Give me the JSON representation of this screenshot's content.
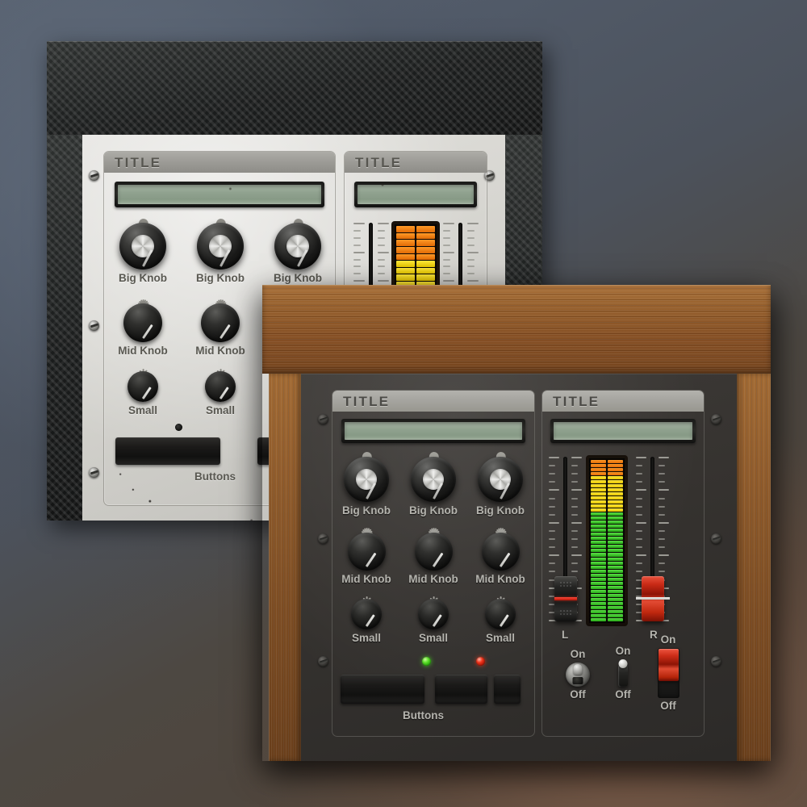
{
  "scene": {
    "background_gradient": [
      "#5d6775",
      "#4c525c",
      "#574c42"
    ],
    "units": [
      "back-carbon-rack",
      "front-wood-rack"
    ]
  },
  "back_unit": {
    "name": "carbon-fiber-rack-unit",
    "chassis_material": "carbon-fiber",
    "faceplate_material": "brushed-aluminum",
    "left_module": {
      "title": "TITLE",
      "display_value": "",
      "big_knobs": [
        {
          "label": "Big Knob",
          "value": 0.28
        },
        {
          "label": "Big Knob",
          "value": 0.28
        },
        {
          "label": "Big Knob",
          "value": 0.28
        }
      ],
      "mid_knobs": [
        {
          "label": "Mid Knob",
          "value": 0.2
        },
        {
          "label": "Mid Knob",
          "value": 0.2
        }
      ],
      "small_knobs": [
        {
          "label": "Small",
          "value": 0.2
        },
        {
          "label": "Small",
          "value": 0.2
        }
      ],
      "buttons_label": "Buttons",
      "buttons": [
        {
          "led": "off"
        },
        {
          "led": "green"
        }
      ]
    },
    "right_module": {
      "title": "TITLE",
      "display_value": "",
      "meter": {
        "total_segments": 20,
        "lit_segments": 20,
        "orange": 5,
        "yellow": 15,
        "green": 0
      }
    }
  },
  "front_unit": {
    "name": "wood-rack-unit",
    "chassis_material": "wood",
    "faceplate_material": "dark-metal",
    "left_module": {
      "title": "TITLE",
      "display_value": "",
      "big_knobs": [
        {
          "label": "Big Knob",
          "value": 0.28
        },
        {
          "label": "Big Knob",
          "value": 0.28
        },
        {
          "label": "Big Knob",
          "value": 0.28
        }
      ],
      "mid_knobs": [
        {
          "label": "Mid Knob",
          "value": 0.2
        },
        {
          "label": "Mid Knob",
          "value": 0.2
        },
        {
          "label": "Mid Knob",
          "value": 0.2
        }
      ],
      "small_knobs": [
        {
          "label": "Small",
          "value": 0.2
        },
        {
          "label": "Small",
          "value": 0.2
        },
        {
          "label": "Small",
          "value": 0.2
        }
      ],
      "buttons_label": "Buttons",
      "buttons": [
        {
          "led": "none"
        },
        {
          "led": "green"
        },
        {
          "led": "red"
        }
      ]
    },
    "right_module": {
      "title": "TITLE",
      "display_value": "",
      "faders": [
        {
          "label": "L",
          "cap": "dark",
          "position": 0.27
        },
        {
          "label": "R",
          "cap": "red",
          "position": 0.27
        }
      ],
      "meter": {
        "total_segments": 40,
        "lit_segments": 40,
        "orange": 4,
        "yellow": 9,
        "green": 27
      },
      "switches": [
        {
          "type": "round-toggle",
          "on_label": "On",
          "off_label": "Off",
          "state": "on"
        },
        {
          "type": "stick-toggle",
          "on_label": "On",
          "off_label": "Off",
          "state": "on"
        },
        {
          "type": "slide-switch",
          "on_label": "On",
          "off_label": "Off",
          "state": "on"
        }
      ]
    }
  },
  "colors": {
    "meter_green": "#3fc32a",
    "meter_yellow": "#f2dc12",
    "meter_orange": "#f07a12",
    "led_green": "#5ce02a",
    "led_red": "#f0331a",
    "lcd_glass": "#90a28f",
    "wood": "#8e5a2a",
    "carbon": "#1b1d1d",
    "aluminum": "#d7d6d1",
    "dark_face": "#35322f"
  }
}
